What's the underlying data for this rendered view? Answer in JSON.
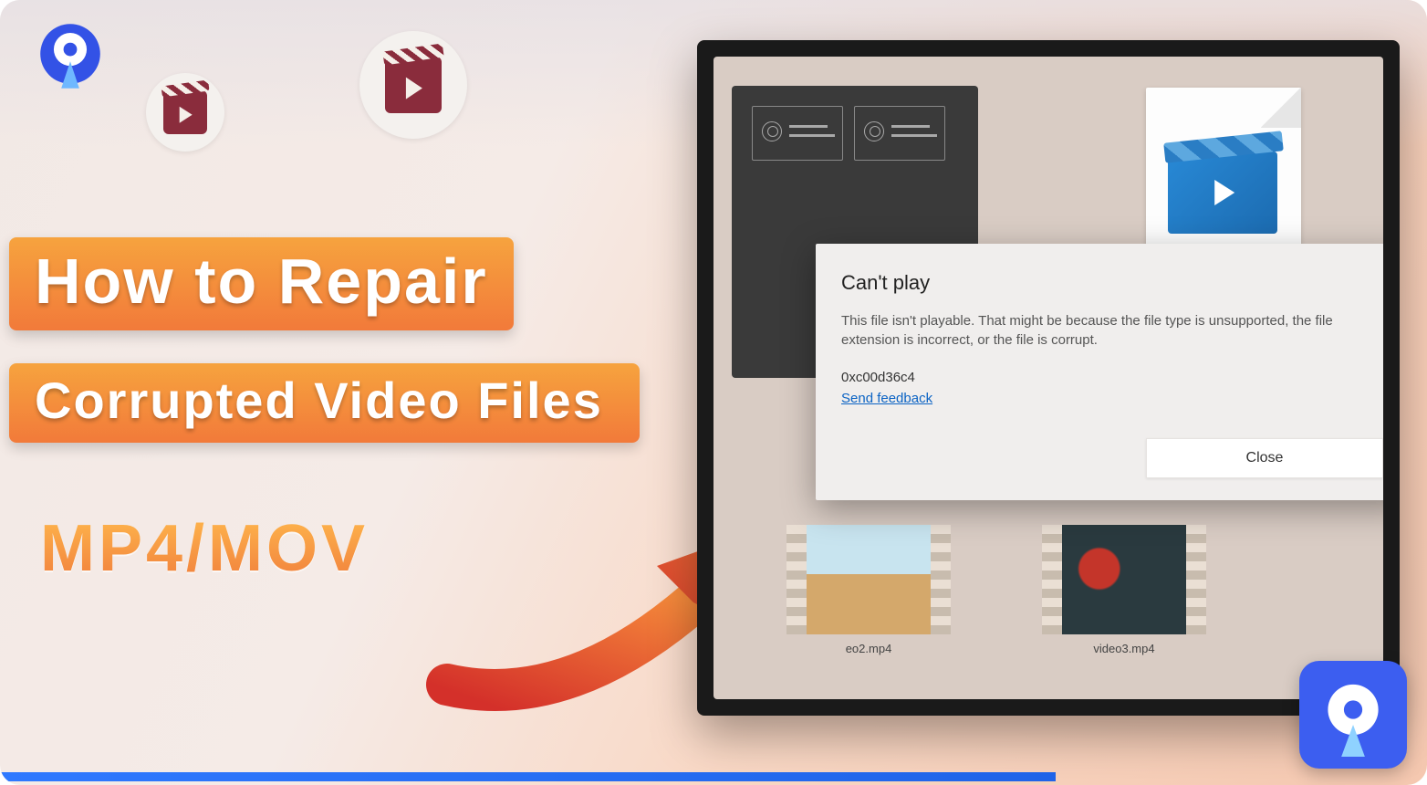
{
  "title": {
    "line1": "How to Repair",
    "line2": "Corrupted Video Files",
    "formats": "MP4/MOV"
  },
  "dialog": {
    "heading": "Can't play",
    "message": "This file isn't playable. That might be because the file type is unsupported, the file extension is incorrect, or the file is corrupt.",
    "error_code": "0xc00d36c4",
    "feedback_link": "Send feedback",
    "close_label": "Close"
  },
  "thumbs": {
    "t1": "eo2.mp4",
    "t2": "video3.mp4"
  },
  "icons": {
    "logo": "recoverit-logo-icon",
    "mini1": "clapper-icon",
    "mini2": "clapper-icon",
    "arrow": "curved-arrow-icon"
  }
}
